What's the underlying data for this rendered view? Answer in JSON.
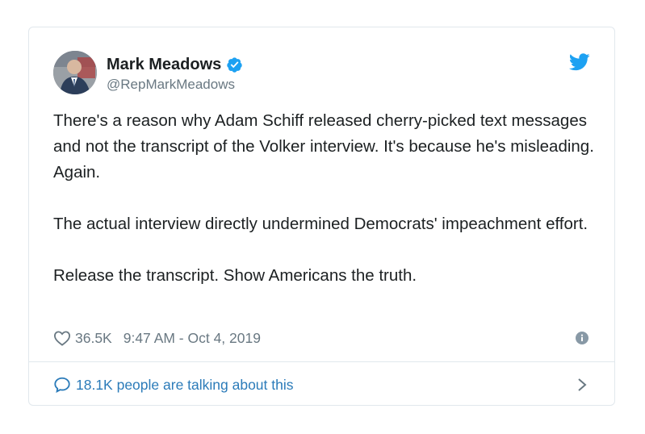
{
  "tweet": {
    "display_name": "Mark Meadows",
    "handle": "@RepMarkMeadows",
    "verified": true,
    "paragraphs": [
      "There's a reason why Adam Schiff released cherry-picked text messages and not the transcript of the Volker interview. It's because he's misleading. Again.",
      "The actual interview directly undermined Democrats' impeachment effort.",
      "Release the transcript. Show Americans the truth."
    ],
    "likes": "36.5K",
    "timestamp": "9:47 AM - Oct 4, 2019",
    "talking_about": "18.1K people are talking about this"
  },
  "colors": {
    "brand_blue": "#1da1f2",
    "link_blue": "#2b7bb9",
    "secondary_text": "#697882",
    "border": "#e1e8ed"
  },
  "icons": [
    "verified-badge-icon",
    "twitter-bird-icon",
    "heart-icon",
    "info-icon",
    "speech-bubble-icon",
    "chevron-right-icon"
  ]
}
